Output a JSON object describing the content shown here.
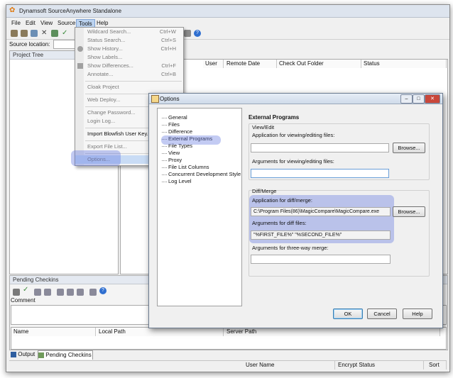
{
  "window": {
    "title": "Dynamsoft SourceAnywhere Standalone"
  },
  "menubar": [
    "File",
    "Edit",
    "View",
    "Source",
    "Tools",
    "Help"
  ],
  "source_location_label": "Source location:",
  "project_tree_title": "Project Tree",
  "file_columns": [
    "User",
    "Remote Date",
    "Check Out Folder",
    "Status"
  ],
  "tools_menu": [
    {
      "label": "Wildcard Search...",
      "shortcut": "Ctrl+W",
      "disabled": true
    },
    {
      "label": "Status Search...",
      "shortcut": "Ctrl+S",
      "disabled": true
    },
    {
      "label": "Show History...",
      "shortcut": "Ctrl+H",
      "disabled": true
    },
    {
      "label": "Show Labels...",
      "shortcut": "",
      "disabled": true
    },
    {
      "label": "Show Differences...",
      "shortcut": "Ctrl+F",
      "disabled": true
    },
    {
      "label": "Annotate...",
      "shortcut": "Ctrl+B",
      "disabled": true
    },
    {
      "label": "Cloak Project",
      "shortcut": "",
      "disabled": true
    },
    {
      "label": "Web Deploy...",
      "shortcut": "",
      "disabled": true
    },
    {
      "label": "Change Password...",
      "shortcut": "",
      "disabled": true
    },
    {
      "label": "Login Log...",
      "shortcut": "",
      "disabled": true
    },
    {
      "label": "Import Blowfish User Key...",
      "shortcut": "",
      "disabled": false
    },
    {
      "label": "Export File List...",
      "shortcut": "",
      "disabled": true
    },
    {
      "label": "Options...",
      "shortcut": "",
      "disabled": false
    }
  ],
  "options_dialog": {
    "title": "Options",
    "tree": [
      "General",
      "Files",
      "Difference",
      "External Programs",
      "File Types",
      "View",
      "Proxy",
      "File List Columns",
      "Concurrent Development Style",
      "Log Level"
    ],
    "selected": "External Programs",
    "section_title": "External Programs",
    "view_edit": {
      "legend": "View/Edit",
      "app_label": "Application for viewing/editing files:",
      "app_value": "",
      "args_label": "Arguments for viewing/editing files:",
      "args_value": ""
    },
    "diff_merge": {
      "legend": "Diff/Merge",
      "app_label": "Application for diff/merge:",
      "app_value": "C:\\Program Files(86)\\MagicCompare\\MagicCompare.exe",
      "args_label": "Arguments for diff files:",
      "args_value": "\"%FIRST_FILE%\" \"%SECOND_FILE%\"",
      "three_way_label": "Arguments for three-way merge:",
      "three_way_value": ""
    },
    "browse": "Browse...",
    "ok": "OK",
    "cancel": "Cancel",
    "help": "Help"
  },
  "pending_checkins_title": "Pending Checkins",
  "comment_label": "Comment",
  "pending_columns": [
    "Name",
    "Local Path",
    "Server Path"
  ],
  "bottom_tabs": [
    "Output",
    "Pending Checkins"
  ],
  "status_columns": [
    "User Name",
    "Encrypt Status",
    "Sort"
  ]
}
